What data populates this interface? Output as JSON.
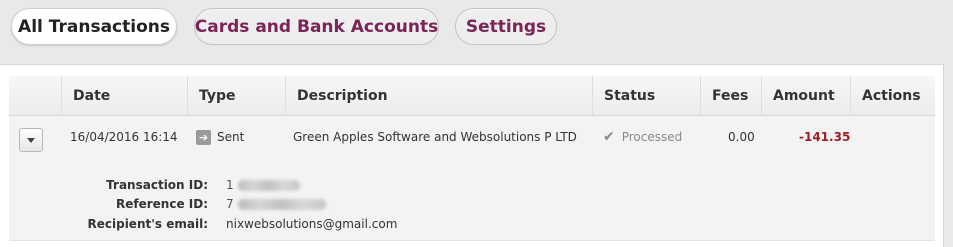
{
  "tabs": [
    {
      "label": "All Transactions",
      "active": true
    },
    {
      "label": "Cards and Bank Accounts",
      "active": false
    },
    {
      "label": "Settings",
      "active": false
    }
  ],
  "table": {
    "columns": [
      "Date",
      "Type",
      "Description",
      "Status",
      "Fees",
      "Amount",
      "Actions"
    ],
    "rows": [
      {
        "date": "16/04/2016 16:14",
        "type": "Sent",
        "type_icon": "arrow-right-icon",
        "description": "Green Apples Software and Websolutions P LTD",
        "status": "Processed",
        "status_icon": "checkmark-icon",
        "fees": "0.00",
        "amount": "-141.35",
        "details": {
          "transaction_id_label": "Transaction ID:",
          "transaction_id_visible": "1",
          "reference_id_label": "Reference ID:",
          "reference_id_visible": "7",
          "recipient_email_label": "Recipient's email:",
          "recipient_email": "nixwebsolutions@gmail.com"
        }
      }
    ]
  },
  "colors": {
    "active_tab_text": "#222222",
    "inactive_tab_text": "#7b2457",
    "amount_negative": "#9b1f1f",
    "status_processed": "#8a8a8a"
  }
}
